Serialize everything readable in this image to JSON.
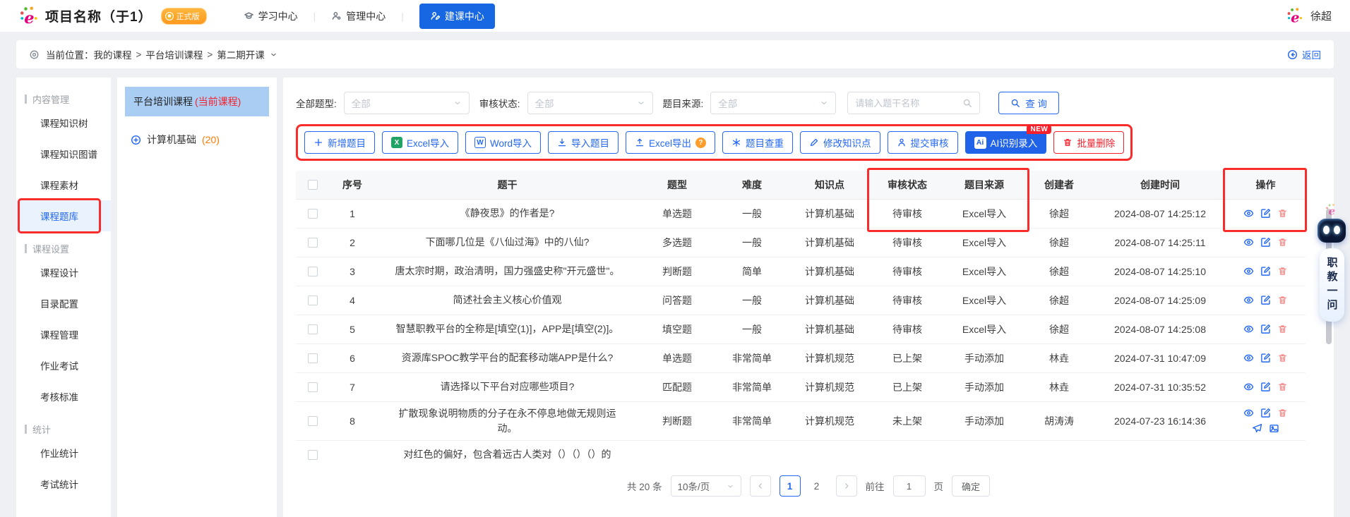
{
  "header": {
    "app_title": "项目名称（于1）",
    "version_badge": "正式版",
    "nav": [
      {
        "id": "learn-center",
        "label": "学习中心",
        "icon": "graduate-icon",
        "primary": false
      },
      {
        "id": "manage-center",
        "label": "管理中心",
        "icon": "admin-icon",
        "primary": false
      },
      {
        "id": "build-center",
        "label": "建课中心",
        "icon": "course-build-icon",
        "primary": true
      }
    ],
    "user_name": "徐超"
  },
  "breadcrumb": {
    "location_label": "当前位置：",
    "path": [
      "我的课程",
      "平台培训课程",
      "第二期开课"
    ],
    "back_label": "返回"
  },
  "sidebar": {
    "sections": [
      {
        "title": "内容管理",
        "items": [
          {
            "id": "course-knowledge-tree",
            "label": "课程知识树"
          },
          {
            "id": "course-knowledge-graph",
            "label": "课程知识图谱"
          },
          {
            "id": "course-material",
            "label": "课程素材"
          },
          {
            "id": "course-question-bank",
            "label": "课程题库",
            "active": true,
            "annotated": true
          }
        ]
      },
      {
        "title": "课程设置",
        "items": [
          {
            "id": "course-design",
            "label": "课程设计"
          },
          {
            "id": "catalog-config",
            "label": "目录配置"
          },
          {
            "id": "course-manage",
            "label": "课程管理"
          },
          {
            "id": "homework-exam",
            "label": "作业考试"
          },
          {
            "id": "assess-standard",
            "label": "考核标准"
          }
        ]
      },
      {
        "title": "统计",
        "items": [
          {
            "id": "homework-stats",
            "label": "作业统计"
          },
          {
            "id": "exam-stats",
            "label": "考试统计"
          }
        ]
      }
    ]
  },
  "course_tree": {
    "current_course": {
      "name": "平台培训课程",
      "tag": "(当前课程)"
    },
    "nodes": [
      {
        "label": "计算机基础",
        "count": "(20)"
      }
    ]
  },
  "filters": [
    {
      "id": "question-type",
      "label": "全部题型:",
      "value": "全部"
    },
    {
      "id": "audit-status",
      "label": "审核状态:",
      "value": "全部"
    },
    {
      "id": "question-source",
      "label": "题目来源:",
      "value": "全部"
    }
  ],
  "search": {
    "placeholder": "请输入题干名称",
    "button_label": "查 询"
  },
  "toolbar": {
    "buttons": [
      {
        "id": "add-question",
        "label": "新增题目",
        "icon": "plus-icon",
        "style": "outline"
      },
      {
        "id": "excel-import",
        "label": "Excel导入",
        "icon": "excel-icon",
        "style": "outline"
      },
      {
        "id": "word-import",
        "label": "Word导入",
        "icon": "word-icon",
        "style": "outline"
      },
      {
        "id": "import-questions",
        "label": "导入题目",
        "icon": "import-icon",
        "style": "outline"
      },
      {
        "id": "excel-export",
        "label": "Excel导出",
        "icon": "export-icon",
        "style": "outline",
        "help_badge": "?"
      },
      {
        "id": "duplicate-check",
        "label": "题目查重",
        "icon": "dup-check-icon",
        "style": "outline"
      },
      {
        "id": "modify-knowledge",
        "label": "修改知识点",
        "icon": "edit-pen-icon",
        "style": "outline"
      },
      {
        "id": "submit-audit",
        "label": "提交审核",
        "icon": "submit-person-icon",
        "style": "outline"
      },
      {
        "id": "ai-recognize",
        "label": "AI识别录入",
        "icon": "ai-icon",
        "style": "solid",
        "corner_badge": "NEW"
      },
      {
        "id": "batch-delete",
        "label": "批量删除",
        "icon": "delete-icon",
        "style": "danger"
      }
    ]
  },
  "table": {
    "columns": [
      "序号",
      "题干",
      "题型",
      "难度",
      "知识点",
      "审核状态",
      "题目来源",
      "创建者",
      "创建时间",
      "操作"
    ],
    "rows": [
      {
        "no": "1",
        "stem": "《静夜思》的作者是?",
        "type": "单选题",
        "difficulty": "一般",
        "knowledge": "计算机基础",
        "status": "待审核",
        "source": "Excel导入",
        "creator": "徐超",
        "created": "2024-08-07 14:25:12",
        "ops": [
          "view",
          "edit",
          "delete"
        ]
      },
      {
        "no": "2",
        "stem": "下面哪几位是《八仙过海》中的八仙?",
        "type": "多选题",
        "difficulty": "一般",
        "knowledge": "计算机基础",
        "status": "待审核",
        "source": "Excel导入",
        "creator": "徐超",
        "created": "2024-08-07 14:25:11",
        "ops": [
          "view",
          "edit",
          "delete"
        ]
      },
      {
        "no": "3",
        "stem": "唐太宗时期，政治清明，国力强盛史称\"开元盛世\"。",
        "type": "判断题",
        "difficulty": "简单",
        "knowledge": "计算机基础",
        "status": "待审核",
        "source": "Excel导入",
        "creator": "徐超",
        "created": "2024-08-07 14:25:10",
        "ops": [
          "view",
          "edit",
          "delete"
        ]
      },
      {
        "no": "4",
        "stem": "简述社会主义核心价值观",
        "type": "问答题",
        "difficulty": "一般",
        "knowledge": "计算机基础",
        "status": "待审核",
        "source": "Excel导入",
        "creator": "徐超",
        "created": "2024-08-07 14:25:09",
        "ops": [
          "view",
          "edit",
          "delete"
        ]
      },
      {
        "no": "5",
        "stem": "智慧职教平台的全称是[填空(1)]，APP是[填空(2)]。",
        "type": "填空题",
        "difficulty": "一般",
        "knowledge": "计算机基础",
        "status": "待审核",
        "source": "Excel导入",
        "creator": "徐超",
        "created": "2024-08-07 14:25:08",
        "ops": [
          "view",
          "edit",
          "delete"
        ]
      },
      {
        "no": "6",
        "stem": "资源库SPOC教学平台的配套移动端APP是什么?",
        "type": "单选题",
        "difficulty": "非常简单",
        "knowledge": "计算机规范",
        "status": "已上架",
        "source": "手动添加",
        "creator": "林垚",
        "created": "2024-07-31 10:47:09",
        "ops": [
          "view",
          "edit",
          "delete"
        ]
      },
      {
        "no": "7",
        "stem": "请选择以下平台对应哪些项目?",
        "type": "匹配题",
        "difficulty": "非常简单",
        "knowledge": "计算机规范",
        "status": "已上架",
        "source": "手动添加",
        "creator": "林垚",
        "created": "2024-07-31 10:35:52",
        "ops": [
          "view",
          "edit",
          "delete"
        ]
      },
      {
        "no": "8",
        "stem": "扩散现象说明物质的分子在永不停息地做无规则运动。",
        "type": "判断题",
        "difficulty": "非常简单",
        "knowledge": "计算机规范",
        "status": "未上架",
        "source": "手动添加",
        "creator": "胡涛涛",
        "created": "2024-07-23 16:14:36",
        "ops": [
          "view",
          "edit",
          "delete",
          "send",
          "image"
        ]
      }
    ],
    "clipped_row_text": "对红色的偏好，包含着远古人类对（）（）（）的"
  },
  "pagination": {
    "total_label": "共 20 条",
    "page_size": "10条/页",
    "pages": [
      {
        "label": "1",
        "active": true
      },
      {
        "label": "2",
        "active": false
      }
    ],
    "jump_label_prefix": "前往",
    "jump_value": "1",
    "jump_label_suffix": "页",
    "confirm_label": "确定"
  },
  "float_widget": {
    "text": "职教一问"
  },
  "colors": {
    "accent_blue": "#2468f2",
    "solid_blue": "#2163e8",
    "annotation_red": "#f92c2c",
    "danger_red": "#f5222d",
    "badge_orange": "#ff9c2a",
    "count_orange": "#ff7a00",
    "tree_selected_bg": "#a9cdf3",
    "sidebar_active_bg": "#e9f2fd"
  }
}
